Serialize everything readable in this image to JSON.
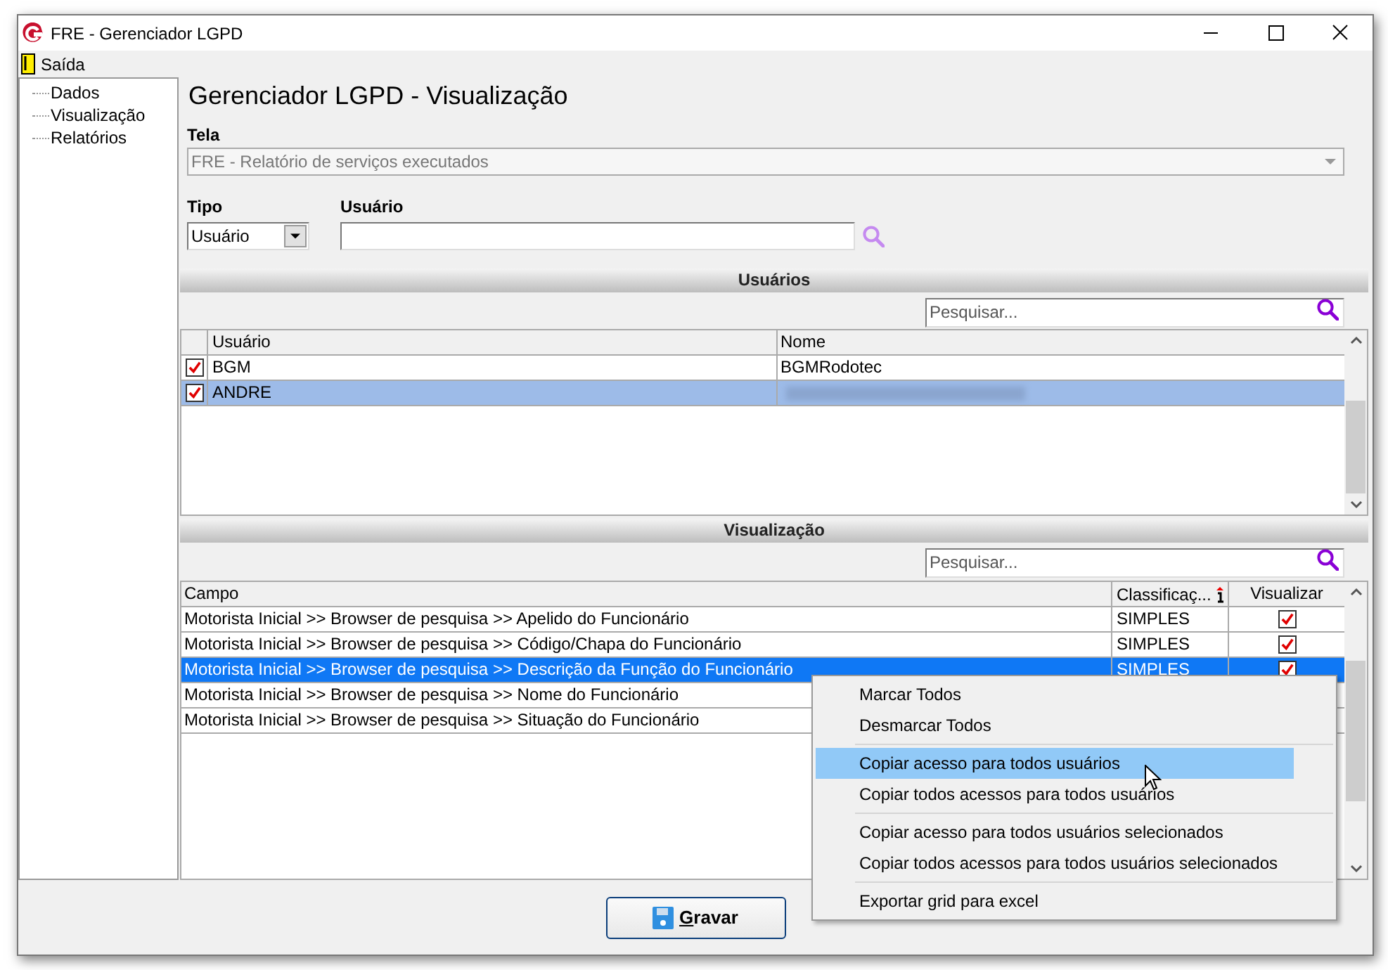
{
  "window": {
    "title": "FRE - Gerenciador LGPD"
  },
  "menu": [
    {
      "label": "Saída"
    }
  ],
  "sidebar": {
    "items": [
      {
        "label": "Dados",
        "selected": false
      },
      {
        "label": "Visualização",
        "selected": false
      },
      {
        "label": "Relatórios",
        "selected": false
      }
    ]
  },
  "heading": "Gerenciador LGPD - Visualização",
  "tela": {
    "label": "Tela",
    "value": "FRE - Relatório de serviços executados",
    "disabled": true
  },
  "tipo": {
    "label": "Tipo",
    "value": "Usuário"
  },
  "usuario": {
    "label": "Usuário"
  },
  "users_section": {
    "title": "Usuários",
    "search": {
      "placeholder": "Pesquisar..."
    },
    "columns": [
      "Usuário",
      "Nome"
    ],
    "rows": [
      {
        "checked": true,
        "selected": false,
        "usuario": "BGM",
        "nome": "BGMRodotec",
        "redacted": false
      },
      {
        "checked": true,
        "selected": true,
        "usuario": "ANDRE",
        "nome": "",
        "redacted": true
      }
    ]
  },
  "view_section": {
    "title": "Visualização",
    "search": {
      "placeholder": "Pesquisar..."
    },
    "columns": [
      "Campo",
      "Classificaç...",
      "Visualizar"
    ],
    "rows": [
      {
        "campo": "Motorista Inicial >> Browser de pesquisa >> Apelido do Funcionário",
        "classificacao": "SIMPLES",
        "visualizar": true,
        "selected": false
      },
      {
        "campo": "Motorista Inicial >> Browser de pesquisa >> Código/Chapa do Funcionário",
        "classificacao": "SIMPLES",
        "visualizar": true,
        "selected": false
      },
      {
        "campo": "Motorista Inicial >> Browser de pesquisa >> Descrição da Função do Funcionário",
        "classificacao": "SIMPLES",
        "visualizar": true,
        "selected": true
      },
      {
        "campo": "Motorista Inicial >> Browser de pesquisa >> Nome do Funcionário",
        "selected": false
      },
      {
        "campo": "Motorista Inicial >> Browser de pesquisa >> Situação do Funcionário",
        "selected": false
      }
    ]
  },
  "context_menu": {
    "groups": [
      [
        {
          "label": "Marcar Todos",
          "selected": false
        },
        {
          "label": "Desmarcar Todos",
          "selected": false
        }
      ],
      [
        {
          "label": "Copiar acesso para todos usuários",
          "selected": true
        },
        {
          "label": "Copiar todos acessos para todos usuários",
          "selected": false
        }
      ],
      [
        {
          "label": "Copiar acesso para todos usuários selecionados",
          "selected": false
        },
        {
          "label": "Copiar todos acessos para todos usuários selecionados",
          "selected": false
        }
      ],
      [
        {
          "label": "Exportar grid para excel",
          "selected": false
        }
      ]
    ]
  },
  "save_button": {
    "label": "Gravar"
  }
}
